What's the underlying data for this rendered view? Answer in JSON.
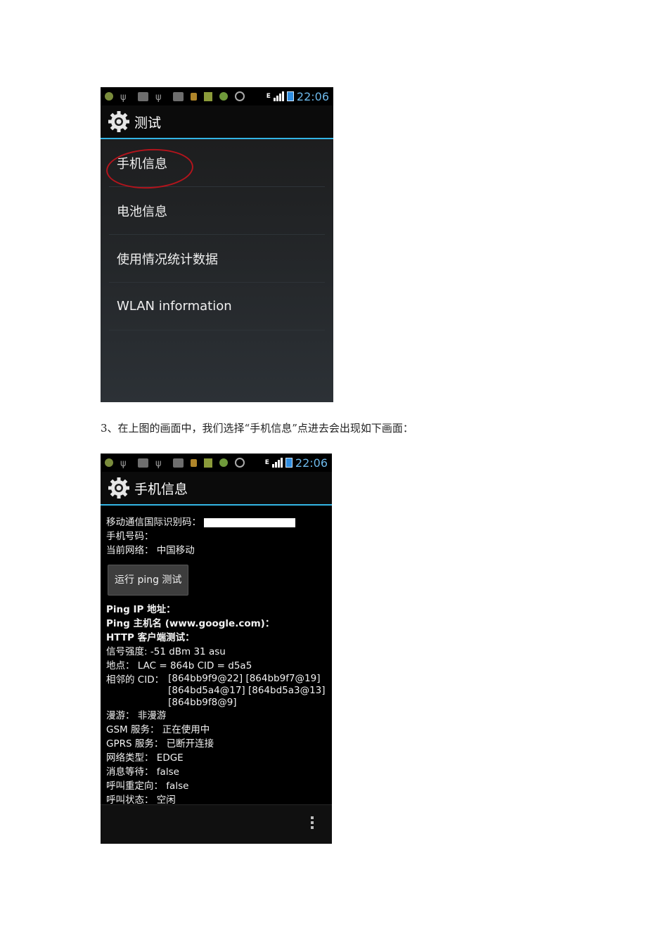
{
  "status_bar": {
    "time": "22:06",
    "network_letter": "E"
  },
  "screen1": {
    "title": "测试",
    "items": [
      {
        "label": "手机信息"
      },
      {
        "label": "电池信息"
      },
      {
        "label": "使用情况统计数据"
      },
      {
        "label": "WLAN information"
      }
    ]
  },
  "caption": "3、在上图的画面中，我们选择“手机信息”点进去会出现如下画面：",
  "screen2": {
    "title": "手机信息",
    "imei_label": "移动通信国际识别码：",
    "phone_label": "手机号码：",
    "network_label": "当前网络：",
    "network_value": "中国移动",
    "ping_button": "运行 ping 测试",
    "ping_ip_label": "Ping IP 地址：",
    "ping_host_label": "Ping 主机名 (www.google.com)：",
    "http_label": "HTTP 客户端测试：",
    "signal_label": "信号强度:",
    "signal_value": "-51 dBm   31 asu",
    "location_label": "地点：",
    "location_value": "LAC = 864b   CID = d5a5",
    "neighbor_label": "相邻的 CID：",
    "neighbor_values": [
      "[864bb9f9@22] [864bb9f7@19]",
      "[864bd5a4@17] [864bd5a3@13]",
      "[864bb9f8@9]"
    ],
    "roaming_label": "漫游：",
    "roaming_value": "非漫游",
    "gsm_label": "GSM 服务：",
    "gsm_value": "正在使用中",
    "gprs_label": "GPRS 服务：",
    "gprs_value": "已断开连接",
    "nettype_label": "网络类型：",
    "nettype_value": "EDGE",
    "msg_label": "消息等待：",
    "msg_value": "false",
    "redirect_label": "呼叫重定向：",
    "redirect_value": "false",
    "call_label": "呼叫状态：",
    "call_value": "空闲"
  },
  "icons": [
    "gear-icon",
    "overflow-menu-icon",
    "signal-icon",
    "battery-icon",
    "alarm-icon"
  ]
}
